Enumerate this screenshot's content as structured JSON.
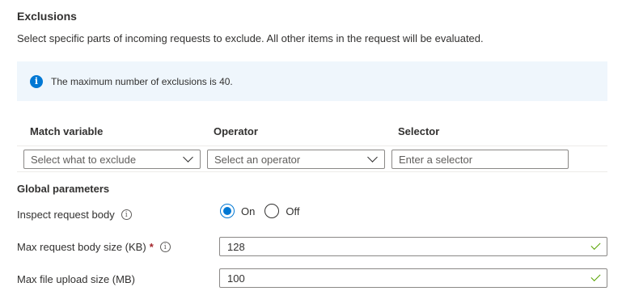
{
  "exclusions": {
    "title": "Exclusions",
    "description": "Select specific parts of incoming requests to exclude. All other items in the request will be evaluated.",
    "info_message": "The maximum number of exclusions is 40.",
    "columns": {
      "match_variable": "Match variable",
      "operator": "Operator",
      "selector": "Selector"
    },
    "row": {
      "match_variable_placeholder": "Select what to exclude",
      "operator_placeholder": "Select an operator",
      "selector_placeholder": "Enter a selector"
    }
  },
  "global_parameters": {
    "title": "Global parameters",
    "inspect_body": {
      "label": "Inspect request body",
      "options": [
        "On",
        "Off"
      ],
      "selected": "On"
    },
    "max_body_size": {
      "label": "Max request body size (KB)",
      "required_marker": "*",
      "value": "128"
    },
    "max_upload_size": {
      "label": "Max file upload size (MB)",
      "value": "100"
    }
  },
  "icons": {
    "info": "info-icon",
    "tooltip": "info-tooltip-icon",
    "chevron": "chevron-down-icon",
    "valid": "checkmark-icon"
  },
  "colors": {
    "accent": "#0078d4",
    "info_background": "#eff6fc",
    "valid": "#57a300",
    "required": "#a4262c"
  }
}
